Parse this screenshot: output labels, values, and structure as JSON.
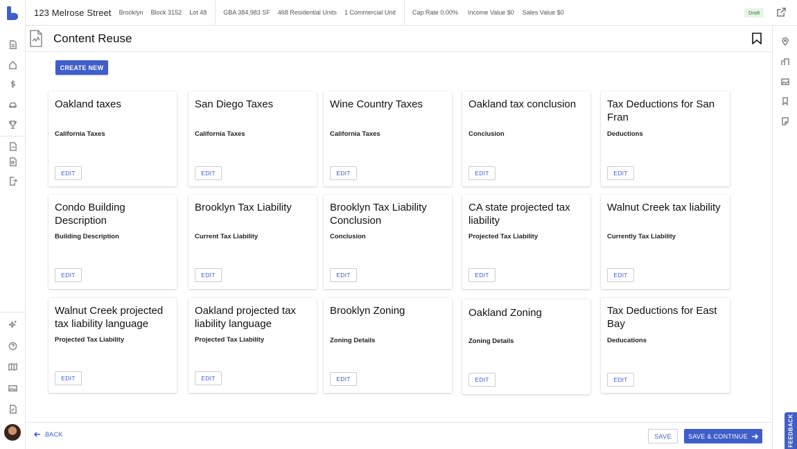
{
  "topbar": {
    "address": "123 Melrose Street",
    "borough": "Brooklyn",
    "block": "Block 3152",
    "lot": "Lot 48",
    "gba": "GBA 384,983 SF",
    "residential_units": "468 Residential Units",
    "commercial_units": "1 Commercial Unit",
    "cap_rate": "Cap Rate 0.00%",
    "income_value": "Income Value $0",
    "sales_value": "Sales Value $0",
    "status": "Draft"
  },
  "header": {
    "title": "Content Reuse"
  },
  "actions": {
    "create_new": "CREATE NEW"
  },
  "cards": [
    {
      "title": "Oakland taxes",
      "subtitle": "California Taxes",
      "edit": "EDIT"
    },
    {
      "title": "San Diego Taxes",
      "subtitle": "California Taxes",
      "edit": "EDIT"
    },
    {
      "title": "Wine Country Taxes",
      "subtitle": "California Taxes",
      "edit": "EDIT"
    },
    {
      "title": "Oakland tax conclusion",
      "subtitle": "Conclusion",
      "edit": "EDIT"
    },
    {
      "title": "Tax Deductions for San Fran",
      "subtitle": "Deductions",
      "edit": "EDIT"
    },
    {
      "title": "Condo Building Description",
      "subtitle": "Building Description",
      "edit": "EDIT"
    },
    {
      "title": "Brooklyn Tax Liability",
      "subtitle": "Current Tax Liability",
      "edit": "EDIT"
    },
    {
      "title": "Brooklyn Tax Liability Conclusion",
      "subtitle": "Conclusion",
      "edit": "EDIT"
    },
    {
      "title": "CA state projected tax liability",
      "subtitle": "Projected Tax Liability",
      "edit": "EDIT"
    },
    {
      "title": "Walnut Creek tax liability",
      "subtitle": "Currently Tax Liability",
      "edit": "EDIT"
    },
    {
      "title": "Walnut Creek projected tax liability language",
      "subtitle": "Projected Tax Liability",
      "edit": "EDIT"
    },
    {
      "title": "Oakland projected tax liability language",
      "subtitle": "Projected Tax Liability",
      "edit": "EDIT"
    },
    {
      "title": "Brooklyn Zoning",
      "subtitle": "Zoning Details",
      "edit": "EDIT"
    },
    {
      "title": "Oakland Zoning",
      "subtitle": "Zoning Details",
      "edit": "EDIT"
    },
    {
      "title": "Tax Deductions for East Bay",
      "subtitle": "Deducations",
      "edit": "EDIT"
    }
  ],
  "footer": {
    "back": "BACK",
    "save": "SAVE",
    "save_continue": "SAVE & CONTINUE"
  },
  "feedback": "FEEDBACK",
  "icons": {
    "left_rail": [
      "document-icon",
      "home-icon",
      "dollar-icon",
      "car-icon",
      "trophy-icon",
      "page-icon",
      "page-search-icon",
      "export-icon",
      "sparkle-icon",
      "help-icon",
      "map-icon",
      "image-icon",
      "edit-document-icon"
    ],
    "right_rail": [
      "location-pin-icon",
      "buildings-icon",
      "photo-icon",
      "bookmark-icon",
      "note-icon"
    ]
  },
  "colors": {
    "primary": "#3f5ec9",
    "draft_bg": "#e6f4e6",
    "draft_text": "#2e7d32"
  }
}
